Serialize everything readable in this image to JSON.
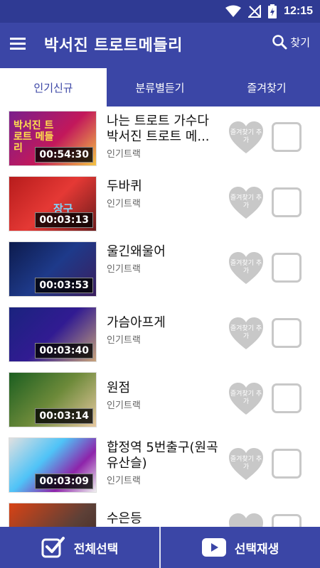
{
  "status_bar": {
    "time": "12:15"
  },
  "app_bar": {
    "title": "박서진 트로트메들리",
    "search_label": "찾기"
  },
  "tabs": [
    {
      "label": "인기신규",
      "active": true
    },
    {
      "label": "분류별듣기",
      "active": false
    },
    {
      "label": "즐겨찾기",
      "active": false
    }
  ],
  "favorite_label": "즐겨찾기 추가",
  "tracks": [
    {
      "title": "나는 트로트 가수다 박서진 트로트 메...",
      "subtitle": "인기트랙",
      "duration": "00:54:30",
      "thumb_text": "박서진 트로트 메들리"
    },
    {
      "title": "두바퀴",
      "subtitle": "인기트랙",
      "duration": "00:03:13",
      "thumb_text": "장구"
    },
    {
      "title": "울긴왜울어",
      "subtitle": "인기트랙",
      "duration": "00:03:53",
      "thumb_text": ""
    },
    {
      "title": "가슴아프게",
      "subtitle": "인기트랙",
      "duration": "00:03:40",
      "thumb_text": ""
    },
    {
      "title": "원점",
      "subtitle": "인기트랙",
      "duration": "00:03:14",
      "thumb_text": ""
    },
    {
      "title": "합정역 5번출구(원곡 유산슬)",
      "subtitle": "인기트랙",
      "duration": "00:03:09",
      "thumb_text": ""
    },
    {
      "title": "수은등",
      "subtitle": "",
      "duration": "",
      "thumb_text": ""
    }
  ],
  "bottom_bar": {
    "select_all": "전체선택",
    "play_selected": "선택재생"
  },
  "colors": {
    "primary": "#3b46a6",
    "status": "#2f3a93",
    "heart": "#c8c8c8"
  }
}
